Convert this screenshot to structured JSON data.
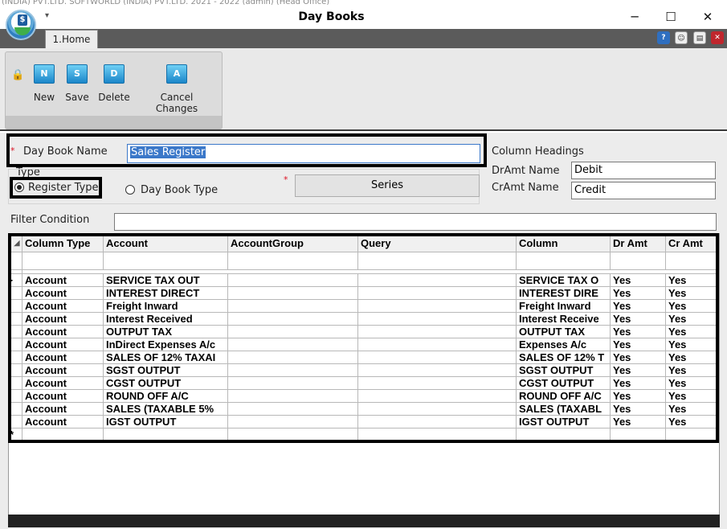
{
  "bg_text": "(INDIA) PVT.LTD.  SOFTWORLD (INDIA) PVT.LTD.  2021 - 2022 (admin) (Head Office)",
  "window": {
    "title": "Day Books",
    "minimize": "─",
    "maximize": "☐",
    "close": "✕"
  },
  "tabs": [
    {
      "label": "1.Home"
    }
  ],
  "ribbon": {
    "buttons": [
      {
        "label": "New",
        "glyph": "N",
        "icon": "new-icon"
      },
      {
        "label": "Save",
        "glyph": "S",
        "icon": "save-icon"
      },
      {
        "label": "Delete",
        "glyph": "D",
        "icon": "delete-icon"
      },
      {
        "label": "Cancel Changes",
        "glyph": "A",
        "icon": "cancel-icon"
      }
    ]
  },
  "form": {
    "day_book_name_label": "Day Book Name",
    "day_book_name_value": "Sales Register",
    "required_mark": "*",
    "type_label": "Type",
    "register_type_label": "Register Type",
    "day_book_type_label": "Day Book Type",
    "series_button": "Series",
    "column_headings_label": "Column Headings",
    "dramt_label": "DrAmt Name",
    "dramt_value": "Debit",
    "cramt_label": "CrAmt Name",
    "cramt_value": "Credit",
    "filter_label": "Filter Condition",
    "filter_value": ""
  },
  "grid": {
    "columns": [
      "Column Type",
      "Account",
      "AccountGroup",
      "Query",
      "Column",
      "Dr Amt",
      "Cr Amt"
    ],
    "rows": [
      [
        "Account",
        "SERVICE TAX OUT",
        "",
        "",
        "SERVICE TAX O",
        "Yes",
        "Yes"
      ],
      [
        "Account",
        "INTEREST DIRECT",
        "",
        "",
        "INTEREST DIRE",
        "Yes",
        "Yes"
      ],
      [
        "Account",
        "Freight Inward",
        "",
        "",
        "Freight Inward",
        "Yes",
        "Yes"
      ],
      [
        "Account",
        "Interest Received",
        "",
        "",
        "Interest Receive",
        "Yes",
        "Yes"
      ],
      [
        "Account",
        "OUTPUT TAX",
        "",
        "",
        "OUTPUT TAX",
        "Yes",
        "Yes"
      ],
      [
        "Account",
        "InDirect Expenses A/c",
        "",
        "",
        "Expenses A/c",
        "Yes",
        "Yes"
      ],
      [
        "Account",
        "SALES OF 12% TAXAI",
        "",
        "",
        "SALES OF 12% T",
        "Yes",
        "Yes"
      ],
      [
        "Account",
        "SGST OUTPUT",
        "",
        "",
        "SGST OUTPUT",
        "Yes",
        "Yes"
      ],
      [
        "Account",
        "CGST OUTPUT",
        "",
        "",
        "CGST OUTPUT",
        "Yes",
        "Yes"
      ],
      [
        "Account",
        "ROUND OFF A/C",
        "",
        "",
        "ROUND OFF A/C",
        "Yes",
        "Yes"
      ],
      [
        "Account",
        "SALES (TAXABLE 5%",
        "",
        "",
        "SALES (TAXABL",
        "Yes",
        "Yes"
      ],
      [
        "Account",
        "IGST OUTPUT",
        "",
        "",
        "IGST OUTPUT",
        "Yes",
        "Yes"
      ]
    ]
  },
  "colors": {
    "accent": "#1b86c9",
    "titlebar_tab": "#5b5b5b",
    "highlight_box": "#000000",
    "selection": "#3b78c9"
  }
}
